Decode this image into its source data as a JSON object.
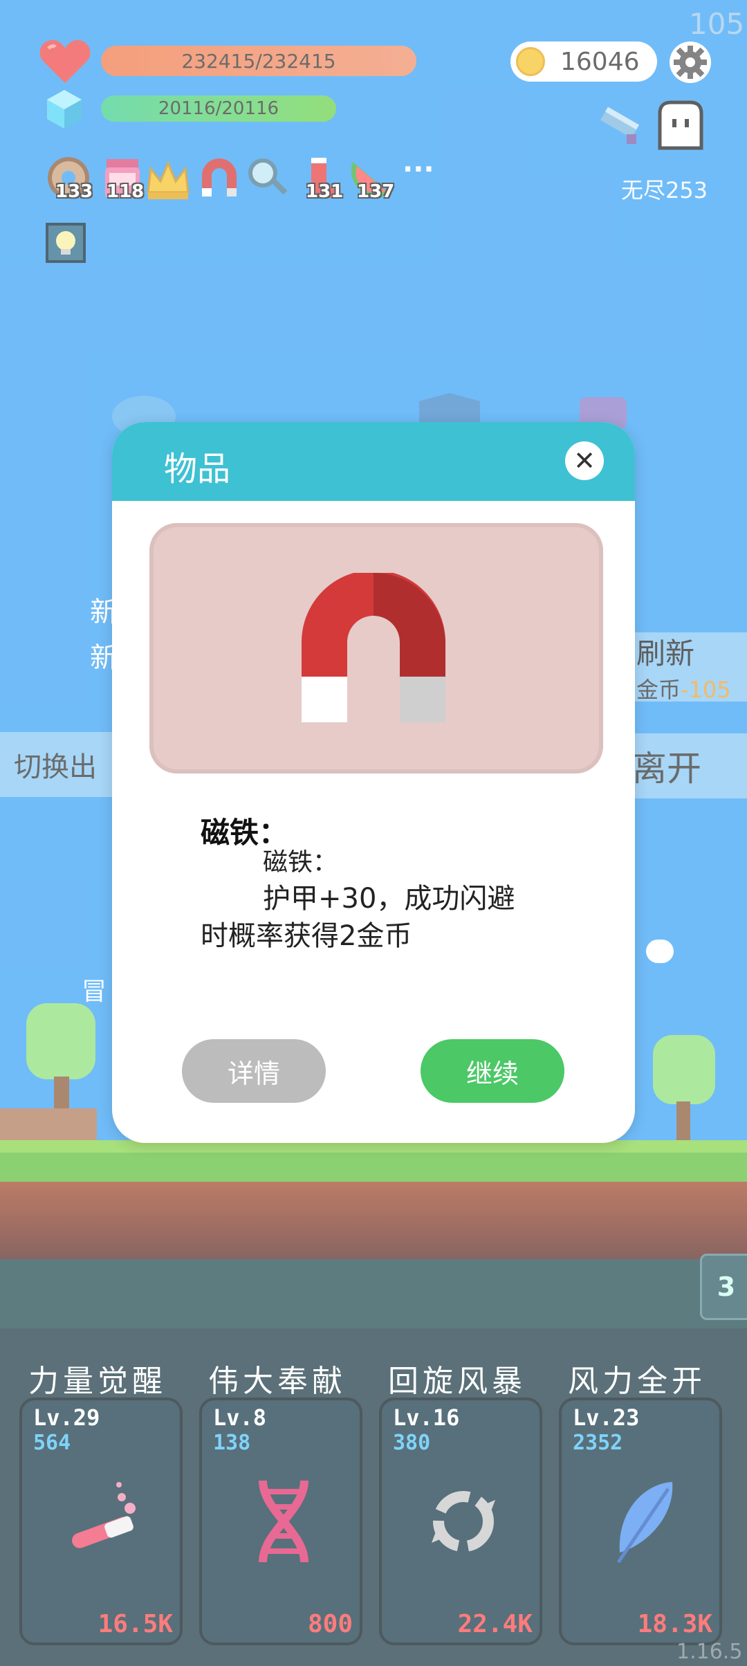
{
  "hud": {
    "hp_text": "232415/232415",
    "mp_text": "20116/20116",
    "coins": "16046",
    "mode_label": "无尽253",
    "fps": "105",
    "version": "1.16.5",
    "items": [
      {
        "name": "donut-icon",
        "count": "133"
      },
      {
        "name": "jam-jar-icon",
        "count": "118"
      },
      {
        "name": "crown-icon",
        "count": ""
      },
      {
        "name": "magnet-icon",
        "count": ""
      },
      {
        "name": "magnifier-icon",
        "count": ""
      },
      {
        "name": "sock-icon",
        "count": "131"
      },
      {
        "name": "watermelon-icon",
        "count": "137"
      }
    ],
    "more": "···"
  },
  "background": {
    "refresh_label": "刷新",
    "refresh_cost_prefix": "金币",
    "refresh_cost": "-105",
    "switch_label": "切换出",
    "leave_label": "离开",
    "new_label_1": "新",
    "new_label_2": "新",
    "npc_tag": "冒",
    "side_counter": "3"
  },
  "modal": {
    "title": "物品",
    "close_symbol": "✕",
    "item_name": "磁铁：",
    "desc_lines": [
      "磁铁：",
      "护甲+30，成功闪避",
      "时概率获得2金币"
    ],
    "detail_button": "详情",
    "continue_button": "继续"
  },
  "skills": [
    {
      "title": "力量觉醒",
      "level": "Lv.29",
      "points": "564",
      "cost": "16.5K",
      "icon": "potion-tube-icon"
    },
    {
      "title": "伟大奉献",
      "level": "Lv.8",
      "points": "138",
      "cost": "800",
      "icon": "dna-icon"
    },
    {
      "title": "回旋风暴",
      "level": "Lv.16",
      "points": "380",
      "cost": "22.4K",
      "icon": "whirlwind-icon"
    },
    {
      "title": "风力全开",
      "level": "Lv.23",
      "points": "2352",
      "cost": "18.3K",
      "icon": "feather-icon"
    }
  ],
  "colors": {
    "sky": "#3aa2f5",
    "hp": "#f07a4a",
    "mp": "#3fcf8e",
    "modal_header": "#3ec1d3",
    "continue": "#4cc866",
    "detail": "#bcbcbc",
    "cost_red": "#ff4a4a",
    "points_blue": "#4fc3f7"
  }
}
